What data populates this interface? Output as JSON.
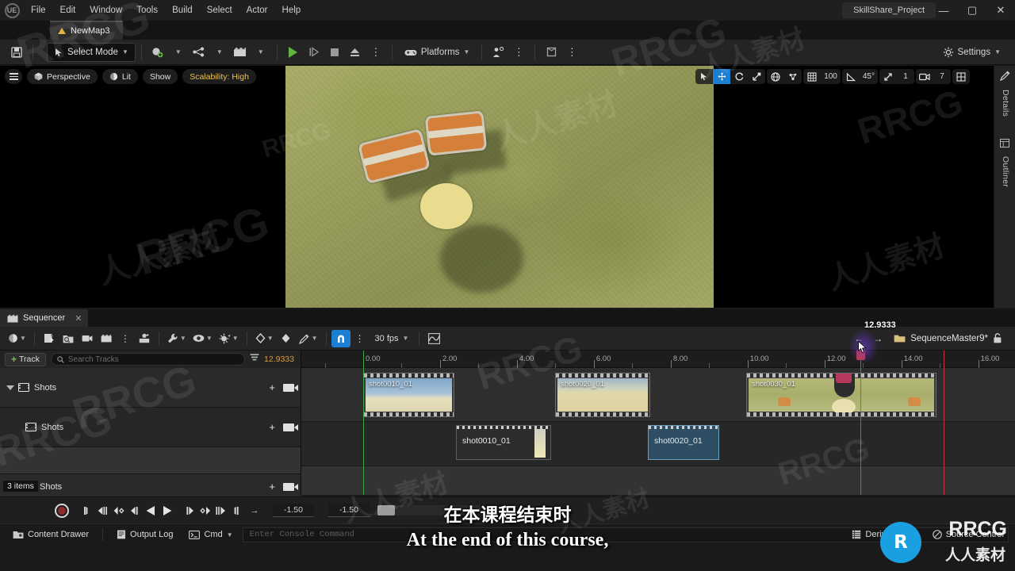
{
  "titlebar": {
    "logo": "UE",
    "menus": [
      "File",
      "Edit",
      "Window",
      "Tools",
      "Build",
      "Select",
      "Actor",
      "Help"
    ],
    "project": "SkillShare_Project",
    "minimize": "—",
    "maximize": "▢",
    "close": "✕"
  },
  "tab": {
    "map_name": "NewMap3"
  },
  "toolbar": {
    "save_icon": "save-icon",
    "select_mode": "Select Mode",
    "platforms": "Platforms",
    "settings": "Settings"
  },
  "viewport": {
    "view_mode": "Perspective",
    "lighting": "Lit",
    "show": "Show",
    "scalability": "Scalability: High",
    "grid_snap_value": "100",
    "angle_snap_value": "45°",
    "scale_snap_value": "1",
    "camera_speed": "7",
    "right_tabs": [
      "Details",
      "Outliner"
    ]
  },
  "sequencer": {
    "tab_label": "Sequencer",
    "tab_close": "✕",
    "fps": "30 fps",
    "sequence_name": "SequenceMaster9*",
    "add_track": "Track",
    "search_placeholder": "Search Tracks",
    "current_timecode": "12.9333",
    "playhead_label": "12.9333",
    "items_count": "3 items",
    "tracks": [
      {
        "label": "Shots",
        "indent": 0
      },
      {
        "label": "Shots",
        "indent": 1
      },
      {
        "label": "Shots",
        "indent": 0
      }
    ],
    "ruler_ticks": [
      "0.00",
      "2.00",
      "4.00",
      "6.00",
      "8.00",
      "10.00",
      "12.00",
      "14.00",
      "16.00"
    ],
    "clips": [
      {
        "name": "shot0010_01",
        "start": 0.1,
        "end": 3.55,
        "thumb": "sky"
      },
      {
        "name": "shot0020_01",
        "start": 5.1,
        "end": 7.5,
        "thumb": "sand"
      },
      {
        "name": "shot0030_01",
        "start": 9.6,
        "end": 14.45,
        "thumb": "field"
      }
    ],
    "subclips": [
      {
        "name": "shot0010_01",
        "start": 2.65,
        "end": 5.2,
        "selected": false
      },
      {
        "name": "shot0020_01",
        "start": 8.35,
        "end": 10.4,
        "selected": true
      }
    ],
    "playhead_time": 12.9333,
    "start_time": -1.5,
    "end_time": 16.0
  },
  "transport": {
    "record": "record-button",
    "start_field": "-1.50",
    "end_field": "-1.50"
  },
  "statusbar": {
    "content_drawer": "Content Drawer",
    "output_log": "Output Log",
    "cmd": "Cmd",
    "console_placeholder": "Enter Console Command",
    "derived_data": "Derived Data",
    "source_control": "Source Control"
  },
  "subtitles": {
    "chinese": "在本课程结束时",
    "english": "At the end of this course,"
  },
  "watermark": {
    "latin": "RRCG",
    "chinese": "人人素材",
    "logo": "R"
  },
  "colors": {
    "accent": "#1b7fd4",
    "scalability": "#e8c351",
    "timecode": "#d89b3c",
    "playhead": "#c33c3c",
    "start_marker": "#3fa44a",
    "brand": "#1a9fe0"
  }
}
